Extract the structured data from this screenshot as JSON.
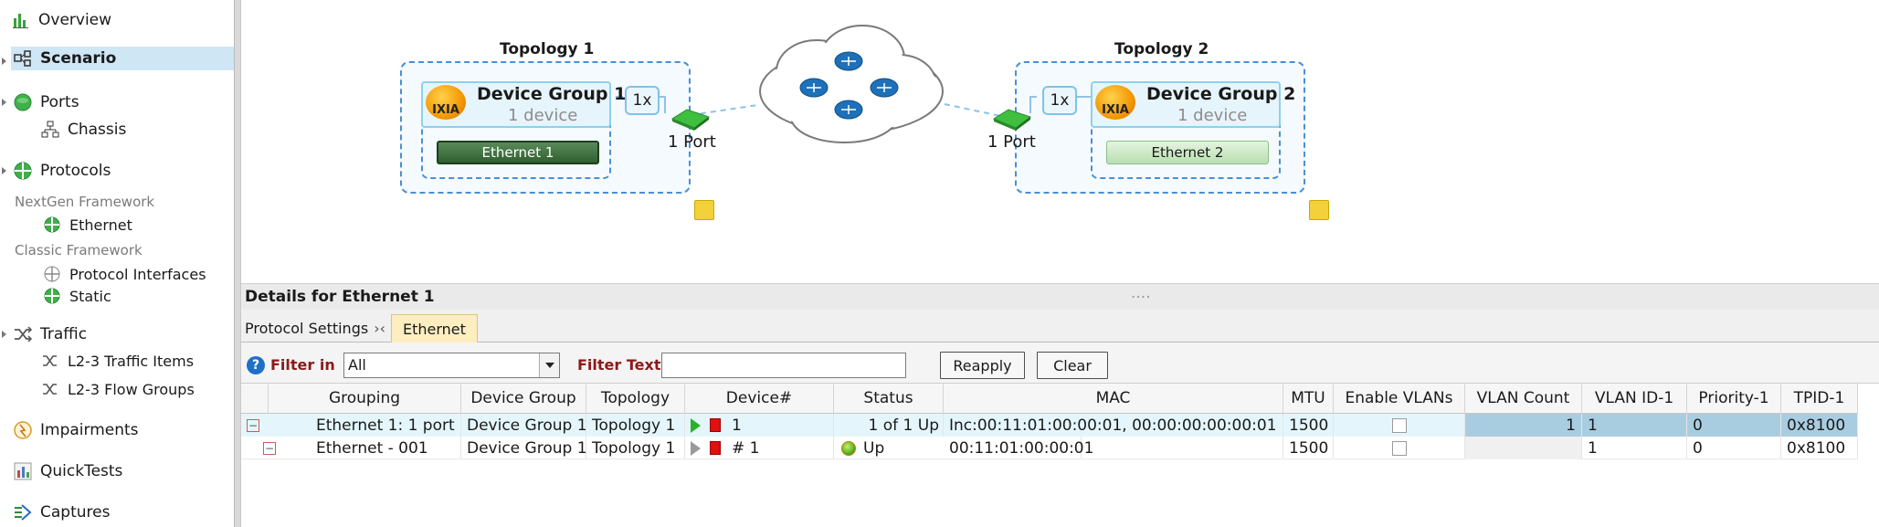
{
  "sidebar": {
    "items": {
      "overview": "Overview",
      "scenario": "Scenario",
      "ports": "Ports",
      "chassis": "Chassis",
      "protocols": "Protocols",
      "nextgen_header": "NextGen Framework",
      "ethernet": "Ethernet",
      "classic_header": "Classic Framework",
      "protocol_interfaces": "Protocol Interfaces",
      "static": "Static",
      "traffic": "Traffic",
      "l23_traffic_items": "L2-3 Traffic Items",
      "l23_flow_groups": "L2-3 Flow Groups",
      "impairments": "Impairments",
      "quicktests": "QuickTests",
      "captures": "Captures"
    }
  },
  "topology": {
    "t1": {
      "title": "Topology 1",
      "dg_name": "Device Group 1",
      "dg_sub": "1 device",
      "mult": "1x",
      "eth": "Ethernet 1",
      "port": "1 Port",
      "logo": "IXIA"
    },
    "t2": {
      "title": "Topology 2",
      "dg_name": "Device Group 2",
      "dg_sub": "1 device",
      "mult": "1x",
      "eth": "Ethernet 2",
      "port": "1 Port",
      "logo": "IXIA"
    }
  },
  "details": {
    "title": "Details for Ethernet 1",
    "grip": "....",
    "tabs": [
      "Protocol Settings",
      "Ethernet"
    ],
    "active_tab": "Ethernet",
    "filter_in_label": "Filter in",
    "filter_in_value": "All",
    "filter_text_label": "Filter Text",
    "filter_text_value": "",
    "reapply": "Reapply",
    "clear": "Clear"
  },
  "grid": {
    "headers": [
      "Grouping",
      "Device Group",
      "Topology",
      "Device#",
      "Status",
      "MAC",
      "MTU",
      "Enable VLANs",
      "VLAN Count",
      "VLAN ID-1",
      "Priority-1",
      "TPID-1"
    ],
    "rows": [
      {
        "grouping": "Ethernet 1: 1 port",
        "device_group": "Device Group 1",
        "topology": "Topology 1",
        "device_num": "1",
        "status": "1 of 1 Up",
        "mac": "Inc:00:11:01:00:00:01, 00:00:00:00:00:01",
        "mtu": "1500",
        "vlan_count": "1",
        "vlan_id": "1",
        "priority": "0",
        "tpid": "0x8100"
      },
      {
        "grouping": "Ethernet - 001",
        "device_group": "Device Group 1",
        "topology": "Topology 1",
        "device_num": "# 1",
        "status": "Up",
        "mac": "00:11:01:00:00:01",
        "mtu": "1500",
        "vlan_count": "",
        "vlan_id": "1",
        "priority": "0",
        "tpid": "0x8100"
      }
    ]
  },
  "colors": {
    "selection": "#cfe6f5",
    "topology_border": "#4a8fd6",
    "accent_green": "#2bb02b"
  }
}
